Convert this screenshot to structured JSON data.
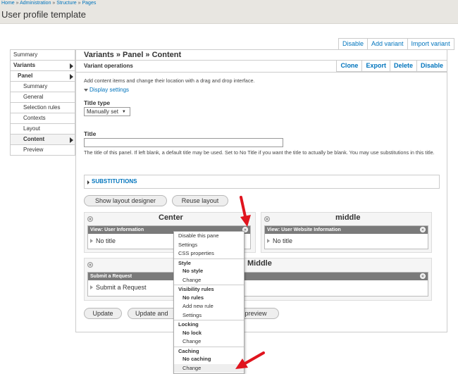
{
  "breadcrumb": [
    "Home",
    "Administration",
    "Structure",
    "Pages"
  ],
  "breadcrumb_sep": "»",
  "page_title": "User profile template",
  "top_buttons": [
    "Disable",
    "Add variant",
    "Import variant"
  ],
  "tabs": {
    "summary": "Summary",
    "variants": "Variants",
    "panel": "Panel",
    "panel_items": [
      "Summary",
      "General",
      "Selection rules",
      "Contexts",
      "Layout",
      "Content",
      "Preview"
    ]
  },
  "content": {
    "heading": "Variants » Panel » Content",
    "ops_label": "Variant operations",
    "ops_buttons": [
      "Clone",
      "Export",
      "Delete",
      "Disable"
    ],
    "intro": "Add content items and change their location with a drag and drop interface.",
    "display_settings": "Display settings",
    "title_type_label": "Title type",
    "title_type_value": "Manually set",
    "title_label": "Title",
    "title_value": "",
    "title_help": "The title of this panel. If left blank, a default title may be used. Set to No Title if you want the title to actually be blank. You may use substitutions in this title.",
    "substitutions": "SUBSTITUTIONS",
    "show_layout_designer": "Show layout designer",
    "reuse_layout": "Reuse layout"
  },
  "regions": {
    "center": "Center",
    "middle": "middle",
    "middle2": "Middle"
  },
  "panes": {
    "user_info_title": "View: User Information",
    "user_info_body": "No title",
    "website_title": "View: User Website Information",
    "website_body": "No title",
    "request_title": "Submit a Request",
    "request_body": "Submit a Request"
  },
  "bottom_buttons": {
    "update": "Update",
    "update_and": "Update and",
    "preview": "preview"
  },
  "dropdown": {
    "disable": "Disable this pane",
    "settings": "Settings",
    "css": "CSS properties",
    "style": "Style",
    "no_style": "No style",
    "style_change": "Change",
    "visibility": "Visibility rules",
    "no_rules": "No rules",
    "add_rule": "Add new rule",
    "vis_settings": "Settings",
    "locking": "Locking",
    "no_lock": "No lock",
    "lock_change": "Change",
    "caching": "Caching",
    "no_caching": "No caching",
    "cache_change": "Change"
  },
  "colors": {
    "link": "#0074bd",
    "annotation_arrow": "#e0141e",
    "pane_bar": "#7a7a7a"
  }
}
